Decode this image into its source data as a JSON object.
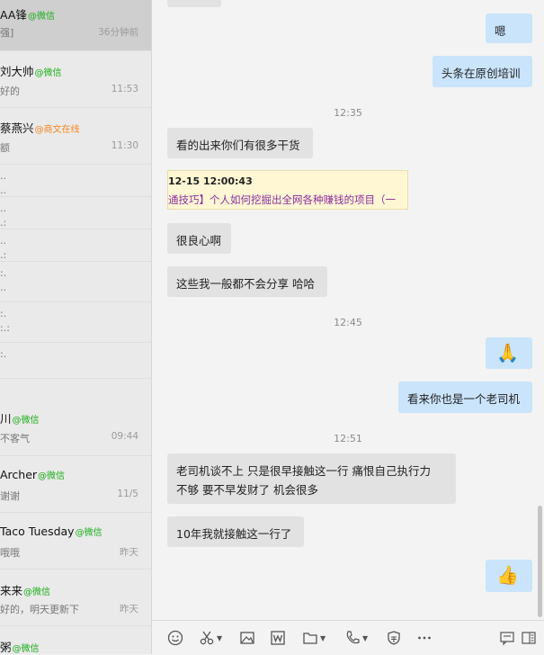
{
  "sidebar": {
    "chats": [
      {
        "name": "AA锋",
        "tag": "@微信",
        "preview": "强]",
        "time": "36分钟前"
      },
      {
        "name": "刘大帅",
        "tag": "@微信",
        "preview": "好的",
        "time": "11:53"
      },
      {
        "name": "蔡燕兴",
        "tag": "@商文在线",
        "preview": "额",
        "time": "11:30"
      },
      {
        "line1": "..",
        "line2": ".."
      },
      {
        "line1": "..",
        "line2": ".:"
      },
      {
        "line1": "..",
        "line2": ".:"
      },
      {
        "line1": ":.",
        "line2": ".."
      },
      {
        "line1": ":.",
        "line2": ":.:"
      },
      {
        "name": "川",
        "tag": "@微信",
        "preview": "不客气",
        "time": "09:44"
      },
      {
        "name": "Archer",
        "tag": "@微信",
        "preview": "谢谢",
        "time": "11/5"
      },
      {
        "name": "Taco Tuesday",
        "tag": "@微信",
        "preview": "哦哦",
        "time": "昨天"
      },
      {
        "name": "来来",
        "tag": "@微信",
        "preview": "好的，明天更新下",
        "time": "昨天"
      },
      {
        "name": "粥",
        "tag": "@微信",
        "preview": "",
        "time": ""
      }
    ]
  },
  "messages": {
    "m1": "嗯",
    "m2": "头条在原创培训",
    "t1": "12:35",
    "m3": "看的出来你们有很多干货",
    "card_time": "12-15 12:00:43",
    "card_title": "通技巧】个人如何挖掘出全网各种赚钱的项目（一",
    "m4": "很良心啊",
    "m5": "这些我一般都不会分享 哈哈",
    "t2": "12:45",
    "m6": "🙏",
    "m7": "看来你也是一个老司机",
    "t3": "12:51",
    "m8a": "老司机谈不上  只是很早接触这一行  痛恨自己执行力",
    "m8b": "不够 要不早发财了 机会很多",
    "m9": "10年我就接触这一行了",
    "m10": "👍"
  },
  "toolbar": {
    "icons": [
      "smile-icon",
      "scissors-icon",
      "image-icon",
      "word-icon",
      "folder-icon",
      "phone-icon",
      "shield-icon",
      "more-icon",
      "chat-mode-icon",
      "sidebar-toggle-icon"
    ]
  }
}
